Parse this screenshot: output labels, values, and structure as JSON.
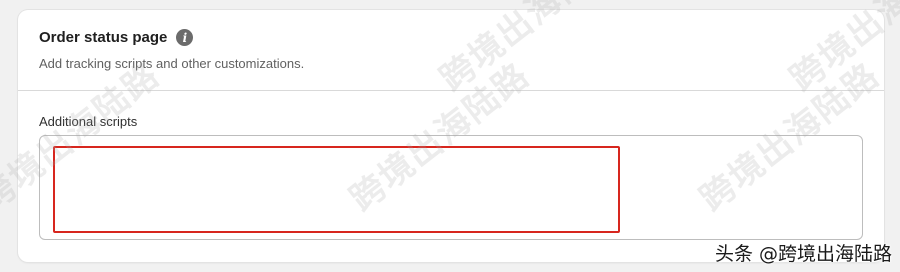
{
  "section": {
    "title": "Order status page",
    "info_icon": "info-icon",
    "subtitle": "Add tracking scripts and other customizations."
  },
  "field": {
    "label": "Additional scripts",
    "value": ""
  },
  "watermark": {
    "text": "跨境出海陆路"
  },
  "credit": {
    "text": "头条 @跨境出海陆路"
  },
  "colors": {
    "highlight": "#d7261e",
    "background": "#f1f1f1",
    "card": "#ffffff"
  }
}
